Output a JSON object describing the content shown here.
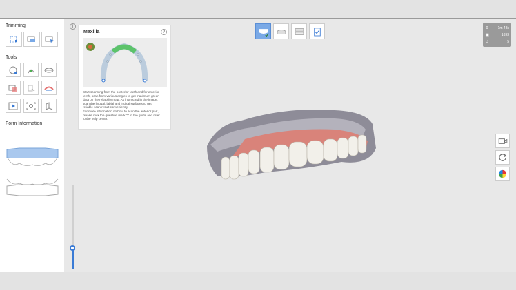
{
  "sidebar": {
    "trimming_title": "Trimming",
    "tools_title": "Tools",
    "form_info_title": "Form Information",
    "tools": [
      {
        "name": "smart-scan-icon"
      },
      {
        "name": "lasso-icon"
      },
      {
        "name": "selection-icon"
      },
      {
        "name": "reliability-map-icon"
      },
      {
        "name": "scan-area-icon"
      },
      {
        "name": "prep-margin-icon"
      },
      {
        "name": "shade-icon"
      },
      {
        "name": "select-tool-icon"
      },
      {
        "name": "model-tool-icon"
      },
      {
        "name": "video-icon"
      },
      {
        "name": "capture-icon"
      },
      {
        "name": "section-icon"
      }
    ]
  },
  "guide": {
    "title": "Maxilla",
    "help": "?",
    "info": "i",
    "lines": [
      "Start scanning from the posterior teeth and for anterior",
      "teeth, scan from various angles to get maximum green",
      "data on the reliability map. As instructed in the image,",
      "scan the lingual, labial and incisal surfaces to get",
      "reliable scan result conveniently.",
      "For more information on how to scan the anterior part,",
      "please click the question mark '?' in the guide and refer",
      "to the help center."
    ]
  },
  "stats": {
    "time": "1m 48s",
    "shots": "1693",
    "count": "5"
  },
  "slider": {
    "level": 0.25
  },
  "colors": {
    "accent": "#3a7bd5",
    "active_tab": "#7aa9e6",
    "stats_bg": "#9a9a9a"
  }
}
